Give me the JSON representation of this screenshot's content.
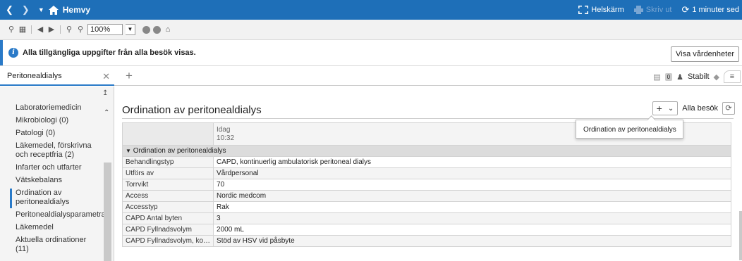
{
  "titlebar": {
    "home_label": "Hemvy",
    "fullscreen_label": "Helskärm",
    "print_label": "Skriv ut",
    "updated_label": "1 minuter sed"
  },
  "toolbar": {
    "zoom_value": "100%"
  },
  "infobar": {
    "message": "Alla tillgängliga uppgifter från alla besök visas.",
    "button_label": "Visa vårdenheter"
  },
  "tabs": {
    "active_tab": "Peritonealdialys",
    "count_badge": "0",
    "stable_label": "Stabilt"
  },
  "sidebar": {
    "items": [
      {
        "label": "Laboratoriemedicin",
        "active": false
      },
      {
        "label": "Mikrobiologi (0)",
        "active": false
      },
      {
        "label": "Patologi (0)",
        "active": false
      },
      {
        "label": "Läkemedel, förskrivna och receptfria (2)",
        "active": false
      },
      {
        "label": "Infarter och utfarter",
        "active": false
      },
      {
        "label": "Vätskebalans",
        "active": false
      },
      {
        "label": "Ordination av peritonealdialys",
        "active": true
      },
      {
        "label": "Peritonealdialysparametrar",
        "active": false
      },
      {
        "label": "Läkemedel",
        "active": false
      },
      {
        "label": "Aktuella ordinationer (11)",
        "active": false
      }
    ]
  },
  "main": {
    "heading": "Ordination av peritonealdialys",
    "all_visits_label": "Alla besök",
    "tooltip": "Ordination av peritonealdialys",
    "column_date": "Idag",
    "column_time": "10:32",
    "group_label": "Ordination av peritonealdialys",
    "rows": [
      {
        "label": "Behandlingstyp",
        "value": "CAPD, kontinuerlig ambulatorisk peritoneal dialys"
      },
      {
        "label": "Utförs av",
        "value": "Vårdpersonal"
      },
      {
        "label": "Torrvikt",
        "value": "70"
      },
      {
        "label": "Access",
        "value": "Nordic medcom"
      },
      {
        "label": "Accesstyp",
        "value": "Rak"
      },
      {
        "label": "CAPD Antal byten",
        "value": "3"
      },
      {
        "label": "CAPD Fyllnadsvolym",
        "value": "2000 mL"
      },
      {
        "label": "CAPD Fyllnadsvolym, ko…",
        "value": "Stöd av HSV vid påsbyte"
      }
    ]
  }
}
